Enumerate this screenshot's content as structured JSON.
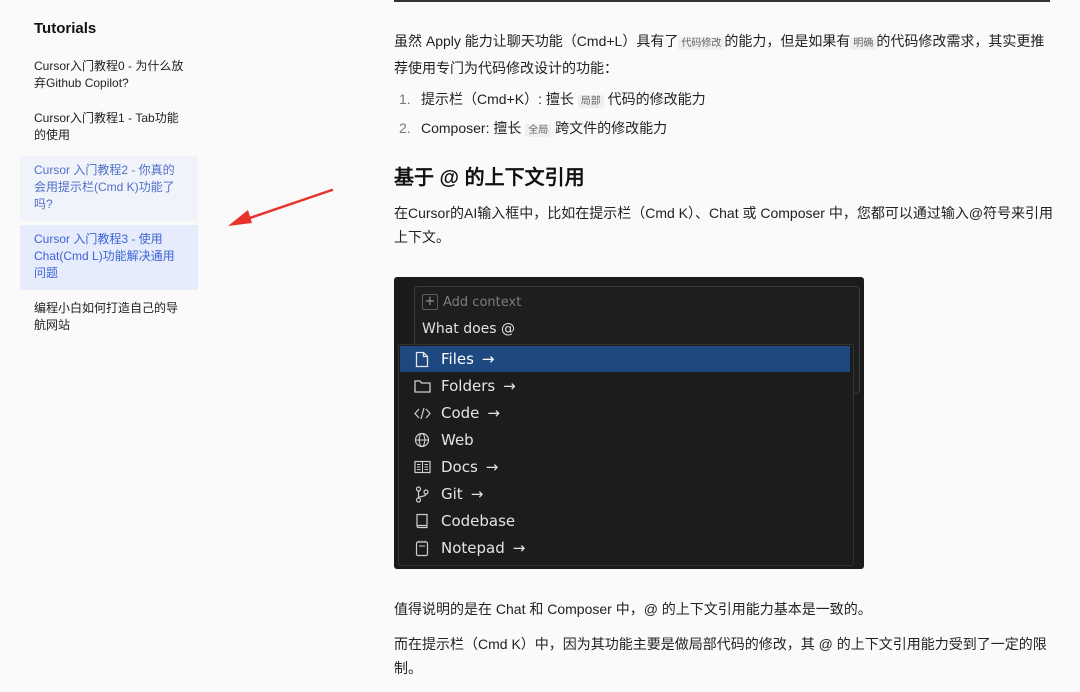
{
  "sidebar": {
    "title": "Tutorials",
    "items": [
      {
        "label": "Cursor入门教程0 - 为什么放弃Github Copilot?"
      },
      {
        "label": "Cursor入门教程1 - Tab功能的使用"
      },
      {
        "label": "Cursor 入门教程2 - 你真的会用提示栏(Cmd K)功能了吗?"
      },
      {
        "label": "Cursor 入门教程3 - 使用 Chat(Cmd L)功能解决通用问题"
      },
      {
        "label": "编程小白如何打造自己的导航网站"
      }
    ]
  },
  "article": {
    "p1": {
      "a": "虽然 Apply 能力让聊天功能（Cmd+L）具有了",
      "code1": "代码修改",
      "b": "的能力，但是如果有",
      "code2": "明确",
      "c": "的代码修改需求，其实更推荐使用专门为代码修改设计的功能："
    },
    "list": [
      {
        "num": "1.",
        "a": "提示栏（Cmd+K）: 擅长",
        "code": "局部",
        "b": "代码的修改能力"
      },
      {
        "num": "2.",
        "a": "Composer: 擅长",
        "code": "全局",
        "b": "跨文件的修改能力"
      }
    ],
    "heading": "基于 @ 的上下文引用",
    "p2": "在Cursor的AI输入框中，比如在提示栏（Cmd K）、Chat 或 Composer 中，您都可以通过输入@符号来引用上下文。",
    "p3": "值得说明的是在 Chat 和 Composer 中，@ 的上下文引用能力基本是一致的。",
    "p4": "而在提示栏（Cmd K）中，因为其功能主要是做局部代码的修改，其 @ 的上下文引用能力受到了一定的限制。"
  },
  "screenshot": {
    "add_context": "Add context",
    "plus": "+",
    "query": "What does @",
    "arrow": "→",
    "menu": [
      {
        "label": "Files",
        "icon": "file-icon",
        "arrow": true,
        "selected": true
      },
      {
        "label": "Folders",
        "icon": "folder-icon",
        "arrow": true
      },
      {
        "label": "Code",
        "icon": "code-icon",
        "arrow": true
      },
      {
        "label": "Web",
        "icon": "globe-icon",
        "arrow": false
      },
      {
        "label": "Docs",
        "icon": "book-icon",
        "arrow": true
      },
      {
        "label": "Git",
        "icon": "git-branch-icon",
        "arrow": true
      },
      {
        "label": "Codebase",
        "icon": "codebase-icon",
        "arrow": false
      },
      {
        "label": "Notepad",
        "icon": "notepad-icon",
        "arrow": true
      }
    ]
  },
  "colors": {
    "accent": "#3e63d8",
    "annotation_arrow": "#e8322a",
    "menu_selected": "#1e4880"
  }
}
